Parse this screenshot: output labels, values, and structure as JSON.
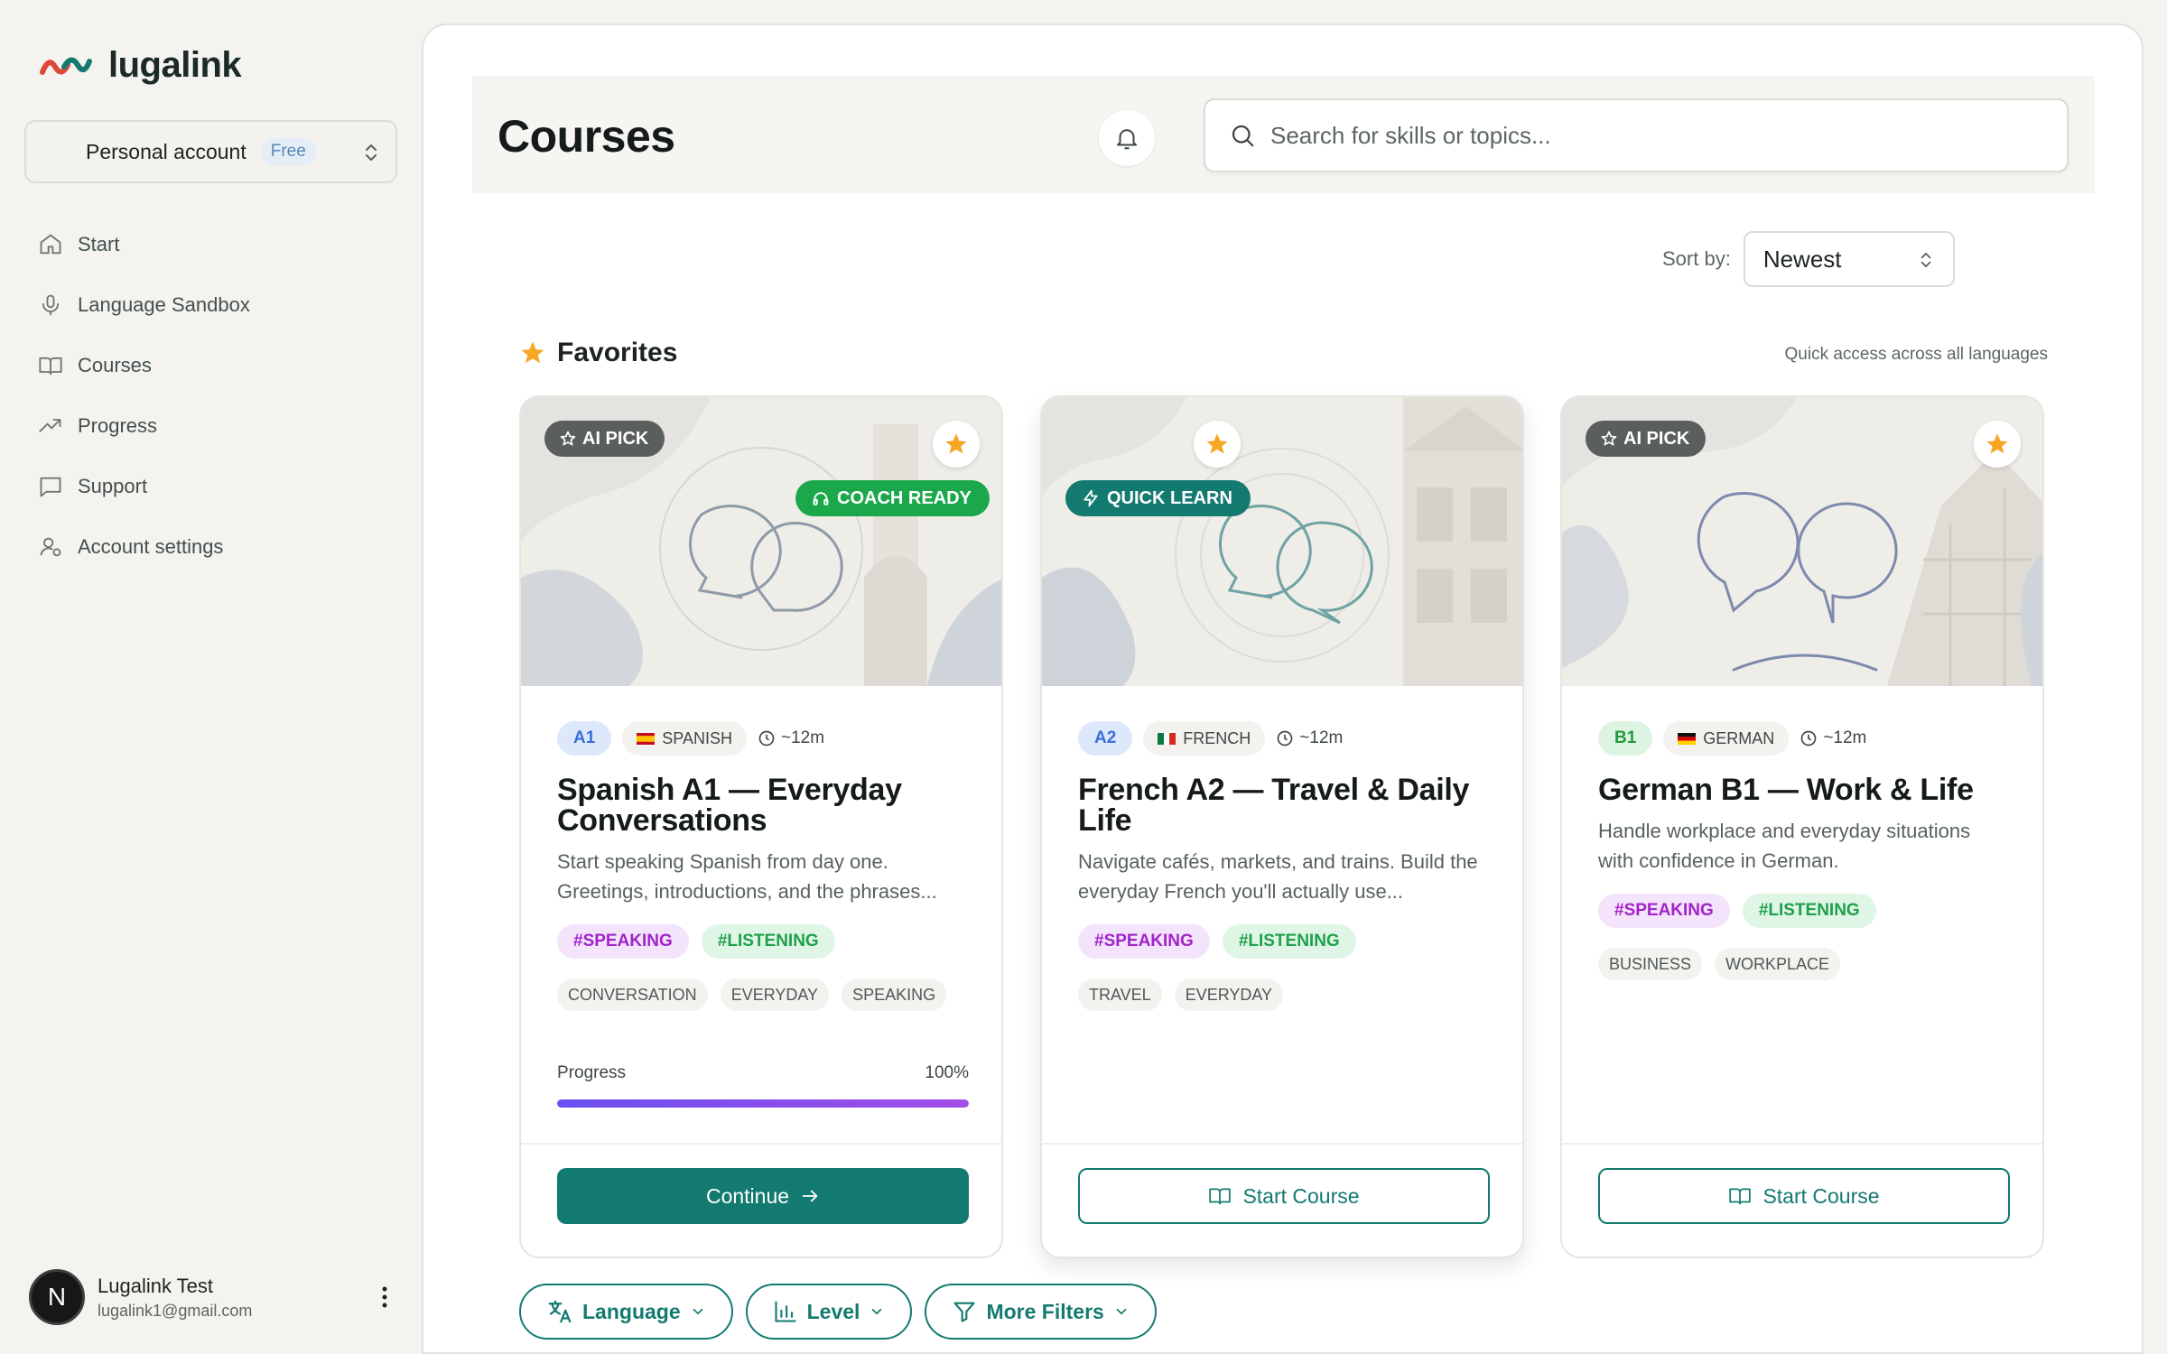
{
  "brand": {
    "name": "lugalink"
  },
  "account": {
    "name": "Personal account",
    "plan": "Free"
  },
  "nav": [
    {
      "label": "Start",
      "icon": "home-icon"
    },
    {
      "label": "Language Sandbox",
      "icon": "microphone-icon"
    },
    {
      "label": "Courses",
      "icon": "book-icon"
    },
    {
      "label": "Progress",
      "icon": "trending-up-icon"
    },
    {
      "label": "Support",
      "icon": "message-icon"
    },
    {
      "label": "Account settings",
      "icon": "user-settings-icon"
    }
  ],
  "user": {
    "initial": "N",
    "name": "Lugalink Test",
    "email": "lugalink1@gmail.com"
  },
  "header": {
    "title": "Courses",
    "search_placeholder": "Search for skills or topics..."
  },
  "sort": {
    "label": "Sort by:",
    "value": "Newest"
  },
  "favorites": {
    "title": "Favorites",
    "note": "Quick access across all languages"
  },
  "colors": {
    "accent": "#137a70",
    "star": "#f5a623",
    "coach_ready": "#1aa84b",
    "quick_learn": "#137a70"
  },
  "cards": [
    {
      "top_badge": "AI PICK",
      "feature_badge": "COACH READY",
      "level": "A1",
      "language": "SPANISH",
      "duration": "~12m",
      "title": "Spanish A1 — Everyday Conversations",
      "description": "Start speaking Spanish from day one. Greetings, introductions, and the phrases...",
      "skills": [
        "#SPEAKING",
        "#LISTENING"
      ],
      "keywords": [
        "CONVERSATION",
        "EVERYDAY",
        "SPEAKING"
      ],
      "progress_label": "Progress",
      "progress_text": "100%",
      "progress_value": 100,
      "action": "Continue"
    },
    {
      "feature_badge": "QUICK LEARN",
      "level": "A2",
      "language": "FRENCH",
      "duration": "~12m",
      "title": "French A2 — Travel & Daily Life",
      "description": "Navigate cafés, markets, and trains. Build the everyday French you'll actually use...",
      "skills": [
        "#SPEAKING",
        "#LISTENING"
      ],
      "keywords": [
        "TRAVEL",
        "EVERYDAY"
      ],
      "action": "Start Course"
    },
    {
      "top_badge": "AI PICK",
      "level": "B1",
      "language": "GERMAN",
      "duration": "~12m",
      "title": "German B1 — Work & Life",
      "description": "Handle workplace and everyday situations with confidence in German.",
      "skills": [
        "#SPEAKING",
        "#LISTENING"
      ],
      "keywords": [
        "BUSINESS",
        "WORKPLACE"
      ],
      "action": "Start Course"
    }
  ],
  "filters": [
    {
      "label": "Language",
      "icon": "translate-icon"
    },
    {
      "label": "Level",
      "icon": "bar-chart-icon"
    },
    {
      "label": "More Filters",
      "icon": "funnel-icon"
    }
  ]
}
